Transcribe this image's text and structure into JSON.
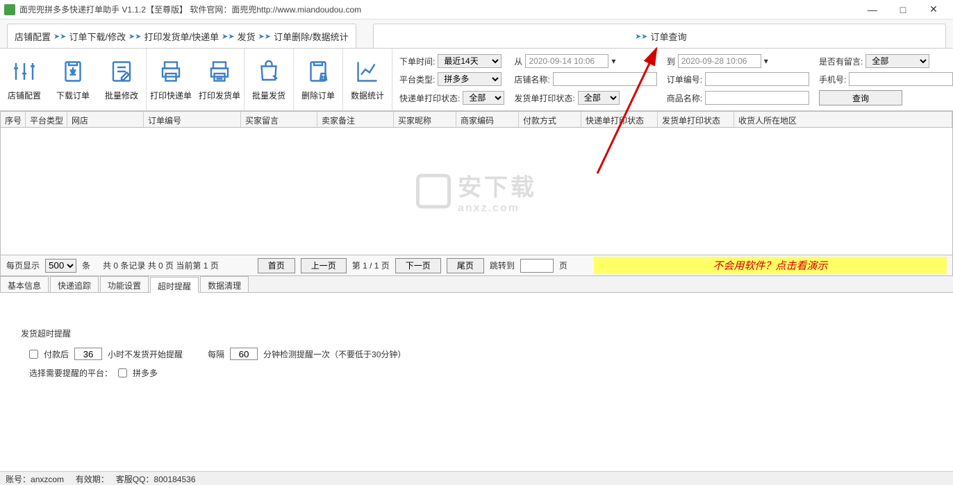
{
  "window": {
    "title": "面兜兜拼多多快递打单助手 V1.1.2【至尊版】   软件官网：面兜兜http://www.miandoudou.com",
    "minimize": "—",
    "maximize": "□",
    "close": "✕"
  },
  "tabs": {
    "seg1": "店铺配置",
    "seg2": "订单下载/修改",
    "seg3": "打印发货单/快递单",
    "seg4": "发货",
    "seg5": "订单删除/数据统计",
    "query_tab": "订单查询"
  },
  "toolbar": {
    "shop_config": "店铺配置",
    "download_order": "下载订单",
    "batch_edit": "批量修改",
    "print_express": "打印快递单",
    "print_delivery": "打印发货单",
    "batch_ship": "批量发货",
    "delete_order": "删除订单",
    "data_stats": "数据统计"
  },
  "filters": {
    "order_time_label": "下单时间:",
    "order_time_value": "最近14天",
    "from_label": "从",
    "from_value": "2020-09-14 10:06",
    "to_label": "到",
    "to_value": "2020-09-28 10:06",
    "has_msg_label": "是否有留言:",
    "has_msg_value": "全部",
    "platform_label": "平台类型:",
    "platform_value": "拼多多",
    "shop_name_label": "店铺名称:",
    "order_no_label": "订单编号:",
    "phone_label": "手机号:",
    "express_print_label": "快递单打印状态:",
    "express_print_value": "全部",
    "delivery_print_label": "发货单打印状态:",
    "delivery_print_value": "全部",
    "product_name_label": "商品名称:",
    "query_btn": "查询"
  },
  "columns": [
    "序号",
    "平台类型",
    "网店",
    "订单编号",
    "买家留言",
    "卖家备注",
    "买家昵称",
    "商家编码",
    "付款方式",
    "快递单打印状态",
    "发货单打印状态",
    "收货人所在地区"
  ],
  "watermark": {
    "main": "安下载",
    "sub": "anxz.com"
  },
  "pager": {
    "per_page_label": "每页显示",
    "per_page_value": "500",
    "unit": "条",
    "total_text": "共  0  条记录   共 0 页   当前第  1  页",
    "first": "首页",
    "prev": "上一页",
    "mid": "第 1  /  1  页",
    "next": "下一页",
    "last": "尾页",
    "jump_label": "跳转到",
    "jump_unit": "页",
    "hint": "不会用软件？点击看演示"
  },
  "subtabs": [
    "基本信息",
    "快递追踪",
    "功能设置",
    "超时提醒",
    "数据清理"
  ],
  "subtab_active_index": 3,
  "panel": {
    "section": "发货超时提醒",
    "after_pay_label": "付款后",
    "after_pay_value": "36",
    "after_pay_suffix": "小时不发货开始提醒",
    "interval_label": "每隔",
    "interval_value": "60",
    "interval_suffix": "分钟检测提醒一次（不要低于30分钟）",
    "platform_label": "选择需要提醒的平台：",
    "platform_option": "拼多多"
  },
  "status": {
    "account_label": "账号：",
    "account": "anxzcom",
    "expire_label": "有效期：",
    "qq_label": "客服QQ：",
    "qq": "800184536"
  }
}
